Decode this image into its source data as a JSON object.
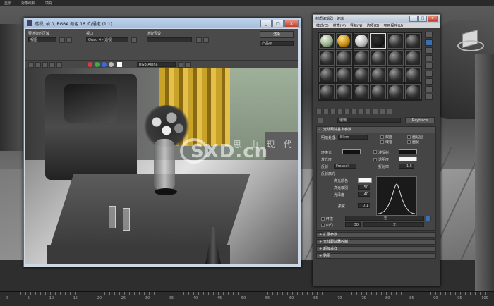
{
  "topbar": {
    "items": [
      "显示",
      "对象绘制",
      "填充",
      ""
    ]
  },
  "render_window": {
    "title": "透视, 帧 0, RGBA 颜色 16 位/通道 (1:1)",
    "area_label": "要渲染的区域",
    "area_value": "视图",
    "viewport_label": "视口",
    "viewport_value": "Quad 4 - 透视",
    "preset_label": "渲染预设",
    "preset_value": "",
    "render_button": "渲染",
    "product_value": "产品级",
    "channel_value": "RGB Alpha",
    "buttons": {
      "min": "_",
      "max": "□",
      "close": "x"
    }
  },
  "material_editor": {
    "title": "材质编辑器 - 玻璃",
    "menu": [
      "模式(D)",
      "材质(M)",
      "导航(N)",
      "选项(O)",
      "实用程序(U)"
    ],
    "material_name": "玻璃",
    "material_type": "Raytrace",
    "basic_params": {
      "header": "光线跟踪基本参数",
      "shading_label": "明暗处理:",
      "shading_value": "Blinn",
      "two_sided": "双面",
      "wire": "线框",
      "faceted": "面贴图",
      "face_map": "面状",
      "ambient": "环境光",
      "diffuse": "漫反射",
      "reflect": "反射",
      "luminosity": "发光度",
      "transparency": "透明度",
      "ior_label": "折射率",
      "ior_value": "1.5",
      "reflect_value": "Fresnel",
      "spec_header": "反射高光",
      "spec_color": "高光颜色",
      "spec_level_label": "高光级别",
      "spec_level": "50",
      "gloss_label": "光泽度",
      "gloss": "40",
      "soften_label": "柔化",
      "soften": "0.1",
      "env_label": "环境",
      "env_value": "无",
      "bump_label": "凹凸",
      "bump_amount": "30",
      "bump_value": "无"
    },
    "rollouts": [
      "扩展参数",
      "光线跟踪器控制",
      "超级采样",
      "贴图"
    ]
  },
  "timeline": {
    "ticks": [
      "0",
      "5",
      "10",
      "15",
      "20",
      "25",
      "30",
      "35",
      "40",
      "45",
      "50",
      "55",
      "60",
      "65",
      "70",
      "75",
      "80",
      "85",
      "90",
      "95",
      "100"
    ]
  },
  "watermark": {
    "logo_text": "SXD.cn",
    "cn_text": "思 山 现 代"
  },
  "colors": {
    "accent": "#3b6fb4",
    "gold": "#c68f12",
    "close": "#c2412b"
  }
}
